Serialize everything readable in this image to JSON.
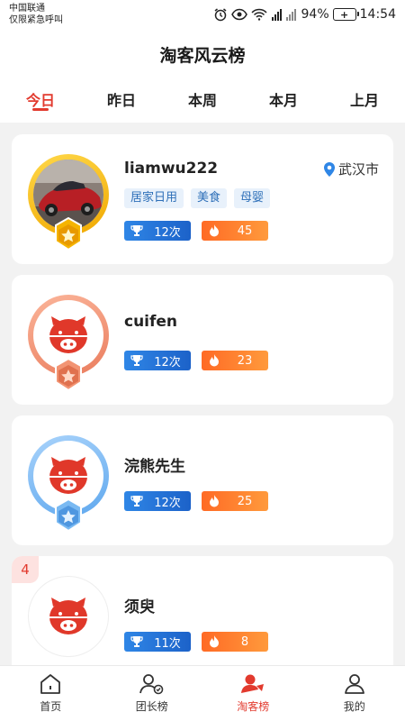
{
  "status": {
    "carrier": "中国联通",
    "emergency": "仅限紧急呼叫",
    "battery": "94%",
    "time": "14:54",
    "icons": [
      "alarm-icon",
      "eye-icon",
      "wifi-icon",
      "signal-icon",
      "battery-icon"
    ]
  },
  "header": {
    "title": "淘客风云榜"
  },
  "tabs": [
    "今日",
    "昨日",
    "本周",
    "本月",
    "上月"
  ],
  "active_tab": "今日",
  "users": [
    {
      "name": "liamwu222",
      "city": "武汉市",
      "tags": [
        "居家日用",
        "美食",
        "母婴"
      ],
      "count": "12次",
      "heat": "45",
      "medal": "gold",
      "avatar": "car-photo"
    },
    {
      "name": "cuifen",
      "count": "12次",
      "heat": "23",
      "medal": "bronze",
      "avatar": "pig-logo"
    },
    {
      "name": "浣熊先生",
      "count": "12次",
      "heat": "25",
      "medal": "silver",
      "avatar": "pig-logo"
    },
    {
      "rank": "4",
      "name": "须臾",
      "count": "11次",
      "heat": "8",
      "avatar": "pig-logo"
    }
  ],
  "colors": {
    "accent": "#e23a2e",
    "blue_badge": "#1c62c9",
    "orange_badge": "#ff7a2a",
    "gold": "#f5b400",
    "bronze": "#f08f6d",
    "silver": "#6bb0f0"
  },
  "nav": [
    {
      "label": "首页",
      "icon": "home-icon"
    },
    {
      "label": "团长榜",
      "icon": "team-leader-icon"
    },
    {
      "label": "淘客榜",
      "icon": "taoke-rank-icon"
    },
    {
      "label": "我的",
      "icon": "profile-icon"
    }
  ],
  "active_nav": "淘客榜"
}
